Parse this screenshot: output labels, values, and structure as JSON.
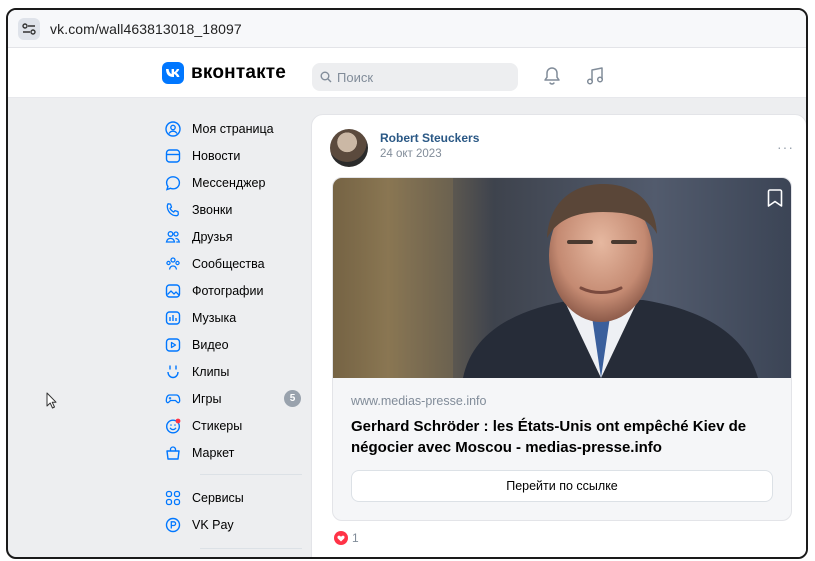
{
  "browser": {
    "url": "vk.com/wall463813018_18097"
  },
  "header": {
    "logo_text": "вконтакте",
    "search_placeholder": "Поиск",
    "accent_color": "#0077ff"
  },
  "sidebar": {
    "items": [
      {
        "label": "Моя страница",
        "icon": "profile-icon"
      },
      {
        "label": "Новости",
        "icon": "news-icon"
      },
      {
        "label": "Мессенджер",
        "icon": "messenger-icon"
      },
      {
        "label": "Звонки",
        "icon": "phone-icon"
      },
      {
        "label": "Друзья",
        "icon": "friends-icon"
      },
      {
        "label": "Сообщества",
        "icon": "communities-icon"
      },
      {
        "label": "Фотографии",
        "icon": "photos-icon"
      },
      {
        "label": "Музыка",
        "icon": "music-icon"
      },
      {
        "label": "Видео",
        "icon": "video-icon"
      },
      {
        "label": "Клипы",
        "icon": "clips-icon"
      },
      {
        "label": "Игры",
        "icon": "games-icon",
        "badge": "5"
      },
      {
        "label": "Стикеры",
        "icon": "stickers-icon"
      },
      {
        "label": "Маркет",
        "icon": "market-icon"
      }
    ],
    "extra_items": [
      {
        "label": "Сервисы",
        "icon": "services-icon"
      },
      {
        "label": "VK Pay",
        "icon": "vkpay-icon"
      }
    ]
  },
  "post": {
    "author": "Robert Steuckers",
    "date": "24 окт 2023",
    "more": "···",
    "link": {
      "host": "www.medias-presse.info",
      "title": "Gerhard Schröder : les États-Unis ont empêché Kiev de négocier avec Moscou - medias-presse.info",
      "button_label": "Перейти по ссылке"
    },
    "likes": "1"
  }
}
